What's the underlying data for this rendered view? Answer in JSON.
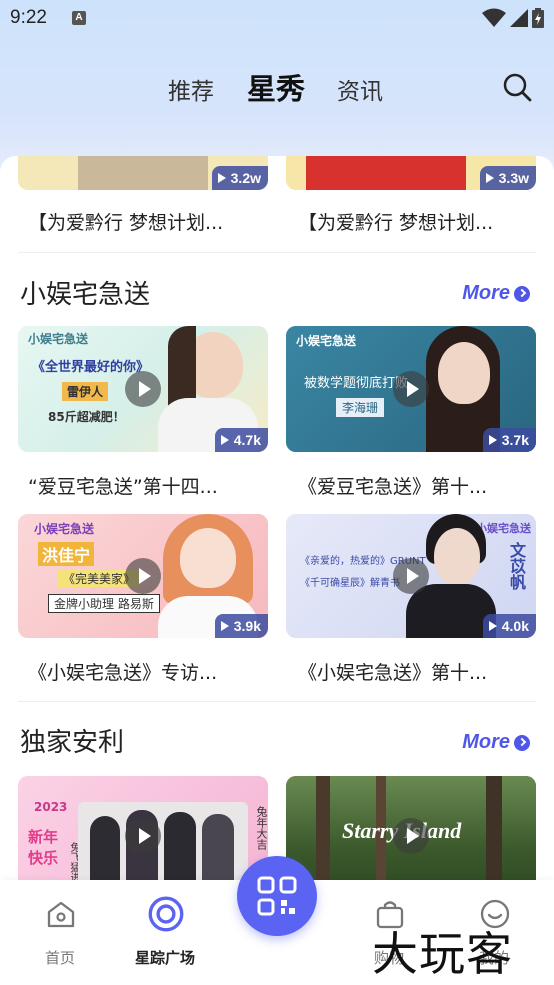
{
  "status_bar": {
    "time": "9:22",
    "notification_icon": "A"
  },
  "top_nav": {
    "tabs": [
      {
        "label": "推荐",
        "active": false
      },
      {
        "label": "星秀",
        "active": true
      },
      {
        "label": "资讯",
        "active": false
      }
    ],
    "search_icon": "search-icon"
  },
  "top_row": {
    "videos": [
      {
        "title": "【为爱黔行 梦想计划...",
        "views": "3.2w"
      },
      {
        "title": "【为爱黔行 梦想计划...",
        "views": "3.3w"
      }
    ]
  },
  "section1": {
    "title": "小娱宅急送",
    "more_label": "More",
    "videos": [
      {
        "title": "“爱豆宅急送”第十四...",
        "views": "4.7k",
        "bg": "#dff2f0",
        "thumb_texts": [
          "小娱宅急送",
          "《全世界最好的你》",
          "雷伊人",
          "85斤超减肥！"
        ]
      },
      {
        "title": "《爱豆宅急送》第十...",
        "views": "3.7k",
        "bg": "#2f6f8a",
        "thumb_texts": [
          "小娱宅急送",
          "被数学题彻底打败",
          "李海珊"
        ]
      },
      {
        "title": "《小娱宅急送》专访...",
        "views": "3.9k",
        "bg": "#f8c9cc",
        "thumb_texts": [
          "小娱宅急送",
          "洪佳宁",
          "《完美美家》",
          "金牌小助理 路易斯"
        ]
      },
      {
        "title": "《小娱宅急送》第十...",
        "views": "4.0k",
        "bg": "#dfe3f7",
        "thumb_texts": [
          "小娱宅急送",
          "《亲爱的，热爱的》GRUNT",
          "《千可确星辰》解青书",
          "文苡帆"
        ]
      }
    ]
  },
  "section2": {
    "title": "独家安利",
    "more_label": "More",
    "videos": [
      {
        "thumb_texts": [
          "2023",
          "新年快乐",
          "兔年大吉",
          "兔飞猛进"
        ],
        "bg": "#f7c4dc"
      },
      {
        "thumb_texts": [
          "Starry Island"
        ],
        "bg": "#4f6b3a"
      }
    ]
  },
  "bottom_nav": {
    "items": [
      {
        "label": "首页",
        "icon": "home-icon",
        "active": false
      },
      {
        "label": "星踪广场",
        "icon": "star-plaza-icon",
        "active": true
      },
      {
        "label": "",
        "icon": "qr-code-icon",
        "active": false
      },
      {
        "label": "购物",
        "icon": "shopping-bag-icon",
        "active": false
      },
      {
        "label": "我的",
        "icon": "profile-icon",
        "active": false
      }
    ]
  },
  "watermark": "大玩客",
  "colors": {
    "accent": "#5b64f2",
    "more": "#4f56e8"
  }
}
